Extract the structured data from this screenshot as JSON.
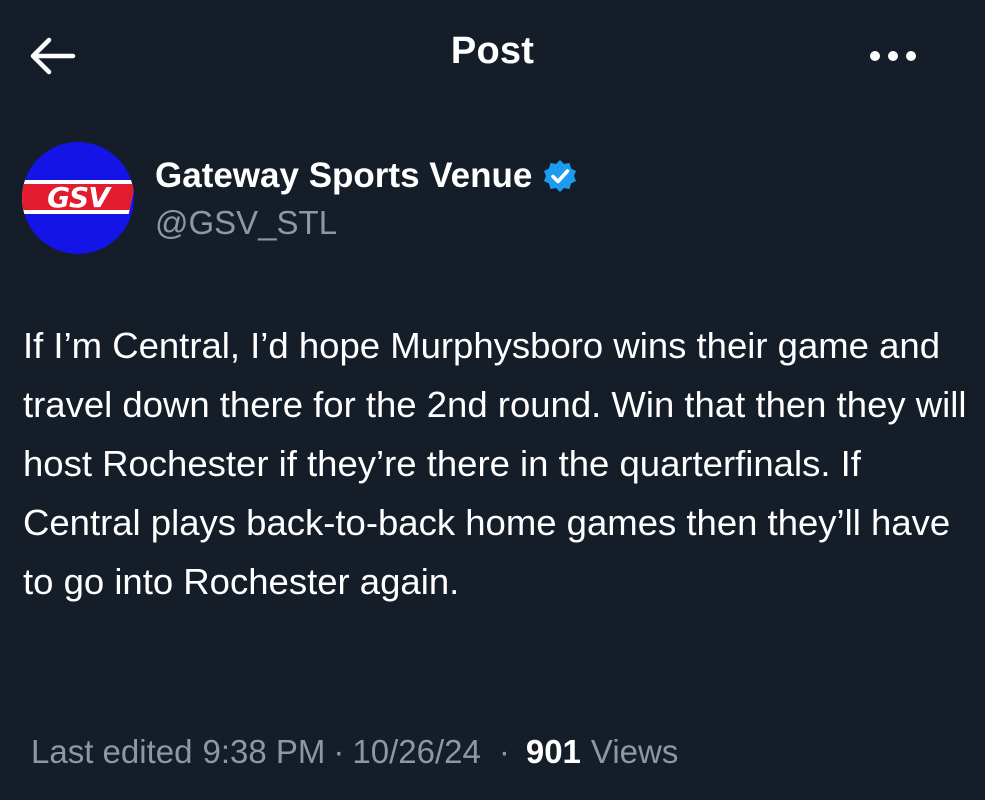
{
  "header": {
    "title": "Post",
    "back_icon": "arrow-left-icon",
    "more_icon": "more-horizontal-icon"
  },
  "author": {
    "display_name": "Gateway Sports Venue",
    "handle": "@GSV_STL",
    "verified": true,
    "avatar_text": "GSV",
    "avatar_color": "#1414e6",
    "verified_color": "#1d9bf0"
  },
  "tweet": {
    "text": "If I’m Central, I’d hope Murphysboro wins their game and travel down there for the 2nd round. Win that then they will host Rochester if they’re there in the quarterfinals. If Central plays back-to-back home games then they’ll have to go into Rochester again."
  },
  "meta": {
    "edited_label": "Last edited",
    "time": "9:38 PM",
    "date": "10/26/24",
    "views_count": "901",
    "views_label": "Views"
  },
  "colors": {
    "background": "#151d28",
    "text": "#ffffff",
    "secondary_text": "#8b98a5"
  }
}
